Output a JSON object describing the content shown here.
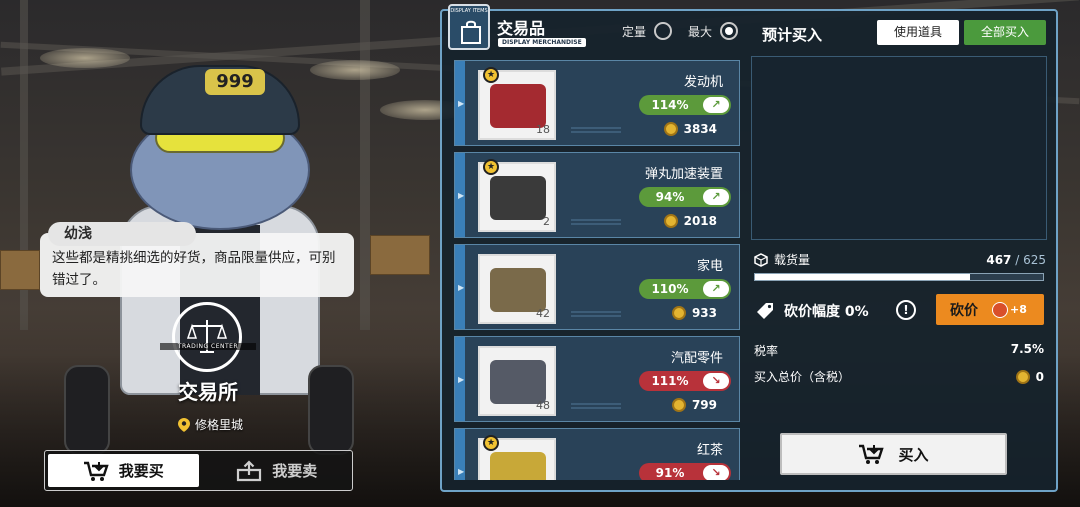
{
  "dialog": {
    "speaker": "幼浅",
    "text": "这些都是精挑细选的好货，商品限量供应，可别错过了。"
  },
  "character": {
    "hat_number": "999"
  },
  "station": {
    "emblem_text": "TRADING CENTER",
    "name": "交易所",
    "location": "修格里城"
  },
  "mode_tabs": [
    {
      "label": "我要买",
      "active": true,
      "icon": "cart-icon"
    },
    {
      "label": "我要卖",
      "active": false,
      "icon": "sell-icon"
    }
  ],
  "panel": {
    "icon_caption": "DISPLAY ITEMS",
    "title": "交易品",
    "subtitle": "DISPLAY MERCHANDISE",
    "options": [
      {
        "label": "定量",
        "selected": false
      },
      {
        "label": "最大",
        "selected": true
      }
    ],
    "estimate_title": "预计买入",
    "use_item_label": "使用道具",
    "buy_all_label": "全部买入"
  },
  "items": [
    {
      "name": "发动机",
      "starred": true,
      "qty": "18",
      "pct": "114%",
      "trend": "up",
      "price": "3834",
      "art_color": "#a42a30"
    },
    {
      "name": "弹丸加速装置",
      "starred": true,
      "qty": "2",
      "pct": "94%",
      "trend": "up",
      "price": "2018",
      "art_color": "#3a3a3a"
    },
    {
      "name": "家电",
      "starred": false,
      "qty": "42",
      "pct": "110%",
      "trend": "up",
      "price": "933",
      "art_color": "#7a6a4a"
    },
    {
      "name": "汽配零件",
      "starred": false,
      "qty": "48",
      "pct": "111%",
      "trend": "down",
      "price": "799",
      "art_color": "#555a66"
    },
    {
      "name": "红茶",
      "starred": true,
      "qty": "",
      "pct": "91%",
      "trend": "down",
      "price": "",
      "art_color": "#c8a838"
    }
  ],
  "cargo": {
    "label": "载货量",
    "current": "467",
    "separator": " / ",
    "max": "625",
    "fill_fraction": 0.747
  },
  "bargain": {
    "label": "砍价幅度 0%",
    "info": "!",
    "button_label": "砍价",
    "bonus": "+8"
  },
  "tax": {
    "label": "税率",
    "value": "7.5%"
  },
  "total": {
    "label": "买入总价（含税）",
    "value": "0"
  },
  "buy_button": {
    "label": "买入"
  },
  "colors": {
    "accent": "#6fa3c7",
    "up": "#5c9a3b",
    "down": "#b8323a",
    "bargain": "#ec8a1f",
    "buy_all": "#4b9a3d"
  }
}
